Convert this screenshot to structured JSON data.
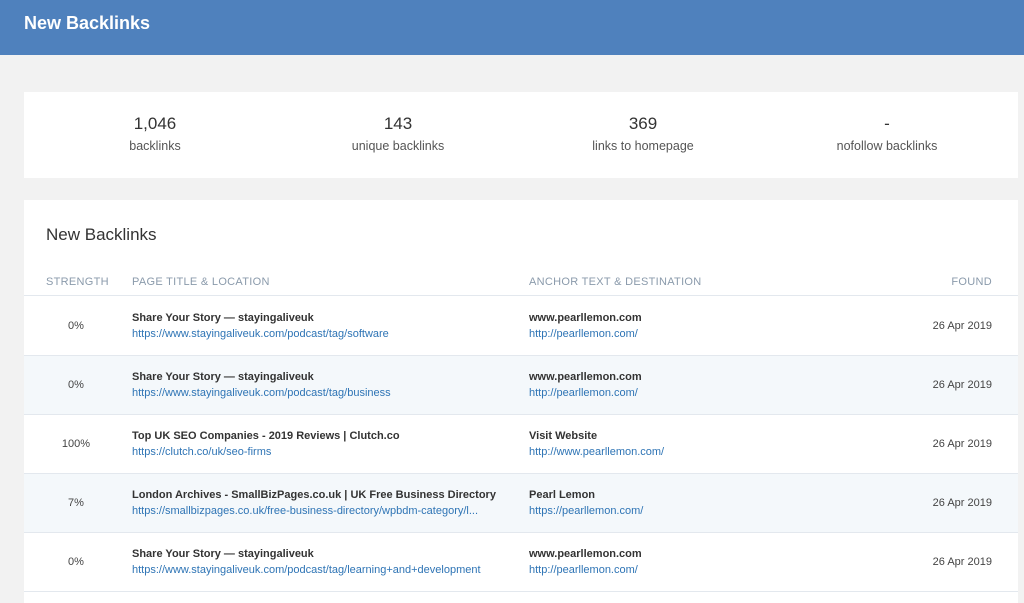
{
  "header": {
    "title": "New Backlinks"
  },
  "stats": [
    {
      "value": "1,046",
      "label": "backlinks"
    },
    {
      "value": "143",
      "label": "unique backlinks"
    },
    {
      "value": "369",
      "label": "links to homepage"
    },
    {
      "value": "-",
      "label": "nofollow backlinks"
    }
  ],
  "panel": {
    "title": "New Backlinks",
    "columns": {
      "strength": "STRENGTH",
      "page": "PAGE TITLE & LOCATION",
      "anchor": "ANCHOR TEXT & DESTINATION",
      "found": "FOUND"
    },
    "rows": [
      {
        "strength": "0%",
        "page_title": "Share Your Story — stayingaliveuk",
        "page_url": "https://www.stayingaliveuk.com/podcast/tag/software",
        "anchor_text": "www.pearllemon.com",
        "destination": "http://pearllemon.com/",
        "found": "26 Apr 2019"
      },
      {
        "strength": "0%",
        "page_title": "Share Your Story — stayingaliveuk",
        "page_url": "https://www.stayingaliveuk.com/podcast/tag/business",
        "anchor_text": "www.pearllemon.com",
        "destination": "http://pearllemon.com/",
        "found": "26 Apr 2019"
      },
      {
        "strength": "100%",
        "page_title": "Top UK SEO Companies - 2019 Reviews | Clutch.co",
        "page_url": "https://clutch.co/uk/seo-firms",
        "anchor_text": "Visit Website",
        "destination": "http://www.pearllemon.com/",
        "found": "26 Apr 2019"
      },
      {
        "strength": "7%",
        "page_title": "London Archives - SmallBizPages.co.uk | UK Free Business Directory",
        "page_url": "https://smallbizpages.co.uk/free-business-directory/wpbdm-category/l...",
        "anchor_text": "Pearl Lemon",
        "destination": "https://pearllemon.com/",
        "found": "26 Apr 2019"
      },
      {
        "strength": "0%",
        "page_title": "Share Your Story — stayingaliveuk",
        "page_url": "https://www.stayingaliveuk.com/podcast/tag/learning+and+development",
        "anchor_text": "www.pearllemon.com",
        "destination": "http://pearllemon.com/",
        "found": "26 Apr 2019"
      }
    ]
  }
}
